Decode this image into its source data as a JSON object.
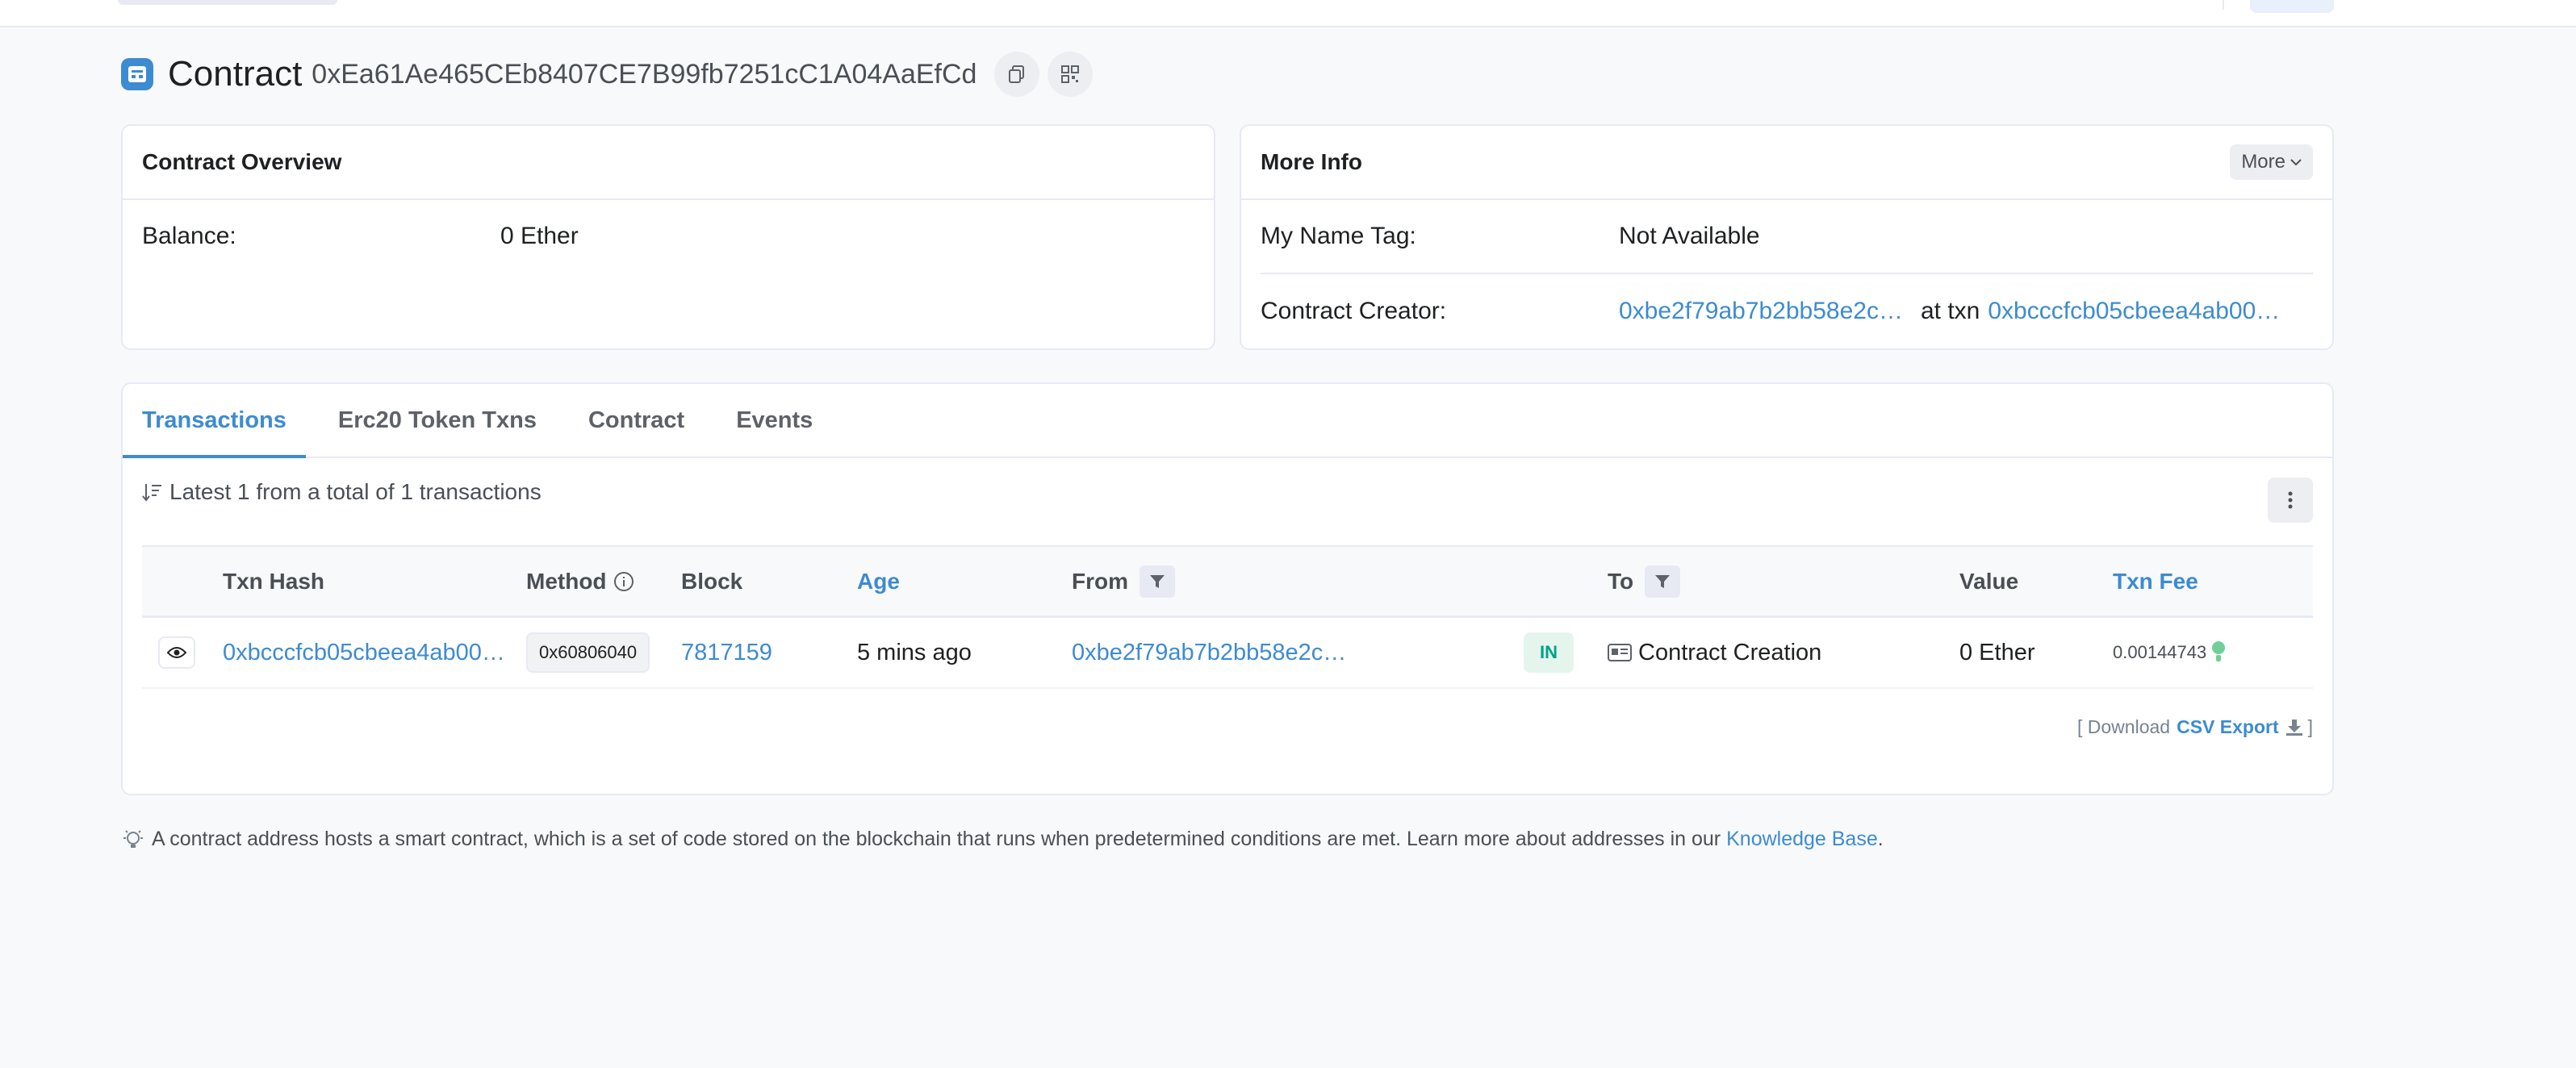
{
  "header": {
    "title": "Contract",
    "address": "0xEa61Ae465CEb8407CE7B99fb7251cC1A04AaEfCd"
  },
  "overview": {
    "title": "Contract Overview",
    "balance_label": "Balance:",
    "balance_value": "0 Ether"
  },
  "more_info": {
    "title": "More Info",
    "more_button": "More",
    "name_tag_label": "My Name Tag:",
    "name_tag_value": "Not Available",
    "creator_label": "Contract Creator:",
    "creator_address": "0xbe2f79ab7b2bb58e2c…",
    "at_txn": "at txn",
    "creator_txn": "0xbcccfcb05cbeea4ab00…"
  },
  "tabs": [
    {
      "label": "Transactions"
    },
    {
      "label": "Erc20 Token Txns"
    },
    {
      "label": "Contract"
    },
    {
      "label": "Events"
    }
  ],
  "summary": "Latest 1 from a total of 1 transactions",
  "table": {
    "columns": {
      "txn_hash": "Txn Hash",
      "method": "Method",
      "block": "Block",
      "age": "Age",
      "from": "From",
      "to": "To",
      "value": "Value",
      "txn_fee": "Txn Fee"
    },
    "rows": [
      {
        "txn_hash": "0xbcccfcb05cbeea4ab00…",
        "method": "0x60806040",
        "block": "7817159",
        "age": "5 mins ago",
        "from": "0xbe2f79ab7b2bb58e2c…",
        "direction": "IN",
        "to": "Contract Creation",
        "value": "0 Ether",
        "fee": "0.00144743"
      }
    ]
  },
  "download": {
    "prefix": "[ Download",
    "link": "CSV Export",
    "suffix": "]"
  },
  "note": {
    "text": "A contract address hosts a smart contract, which is a set of code stored on the blockchain that runs when predetermined conditions are met. Learn more about addresses in our",
    "link": "Knowledge Base",
    "end": "."
  },
  "colors": {
    "accent": "#3d8bd1",
    "success": "#00a186",
    "background": "#f8f9fa"
  }
}
